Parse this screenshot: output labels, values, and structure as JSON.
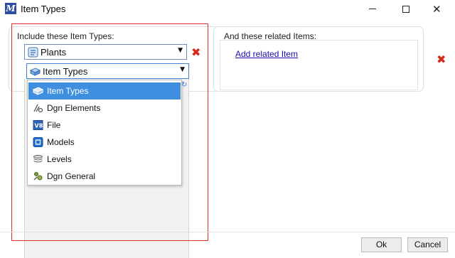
{
  "window": {
    "title": "Item Types",
    "app_icon_letter": "M",
    "controls": {
      "minimize": "minimize",
      "maximize": "maximize",
      "close": "✕"
    }
  },
  "left_panel": {
    "label": "Include these Item Types:",
    "plants_combo": {
      "value": "Plants",
      "icon": "plants-icon"
    },
    "types_combo": {
      "value": "Item Types",
      "icon": "item-types-icon"
    },
    "dropdown_options": [
      {
        "label": "Item Types",
        "icon": "item-types-icon",
        "selected": true
      },
      {
        "label": "Dgn Elements",
        "icon": "dgn-elements-icon",
        "selected": false
      },
      {
        "label": "File",
        "icon": "file-icon",
        "selected": false
      },
      {
        "label": "Models",
        "icon": "models-icon",
        "selected": false
      },
      {
        "label": "Levels",
        "icon": "levels-icon",
        "selected": false
      },
      {
        "label": "Dgn General",
        "icon": "dgn-general-icon",
        "selected": false
      }
    ]
  },
  "right_panel": {
    "label": "And these related Items:",
    "link": "Add related Item"
  },
  "buttons": {
    "ok": "Ok",
    "cancel": "Cancel"
  },
  "colors": {
    "accent_selection": "#3e8fe0",
    "remove_red": "#d8271c",
    "highlight_rect": "#e0302a",
    "link": "#1a0dab"
  }
}
